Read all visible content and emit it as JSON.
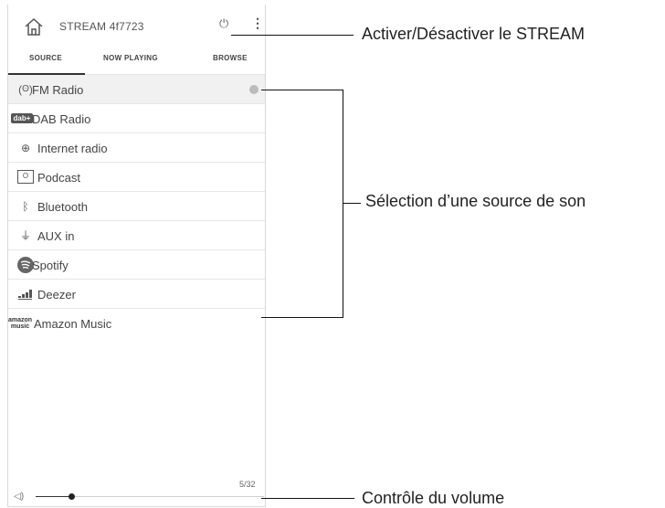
{
  "app": {
    "title": "STREAM 4f7723",
    "tabs": [
      "SOURCE",
      "NOW PLAYING",
      "BROWSE"
    ],
    "active_tab": "SOURCE"
  },
  "sources": [
    {
      "label": "FM Radio",
      "icon": "fm-radio-icon",
      "glyph": "📻",
      "selected": true
    },
    {
      "label": "DAB Radio",
      "icon": "dab-logo-icon",
      "glyph": "dab+",
      "selected": false
    },
    {
      "label": "Internet radio",
      "icon": "globe-icon",
      "glyph": "🌐",
      "selected": false
    },
    {
      "label": "Podcast",
      "icon": "podcast-icon",
      "glyph": "O",
      "selected": false
    },
    {
      "label": "Bluetooth",
      "icon": "bluetooth-icon",
      "glyph": "ᛒ",
      "selected": false
    },
    {
      "label": "AUX in",
      "icon": "aux-plug-icon",
      "glyph": "⏚",
      "selected": false
    },
    {
      "label": "Spotify",
      "icon": "spotify-icon",
      "glyph": "≋",
      "selected": false
    },
    {
      "label": "Deezer",
      "icon": "deezer-icon",
      "glyph": "▁▃▅",
      "selected": false
    },
    {
      "label": "Amazon Music",
      "icon": "amazon-music-icon",
      "glyph": "amazon music",
      "selected": false
    }
  ],
  "volume": {
    "count_text": "5/32",
    "level_fraction": 0.156
  },
  "callouts": {
    "power": "Activer/Désactiver le STREAM",
    "source": "Sélection d’une source de son",
    "volume": "Contrôle du volume"
  },
  "colors": {
    "selected_row": "#f1f1f1",
    "accent": "#333333"
  }
}
